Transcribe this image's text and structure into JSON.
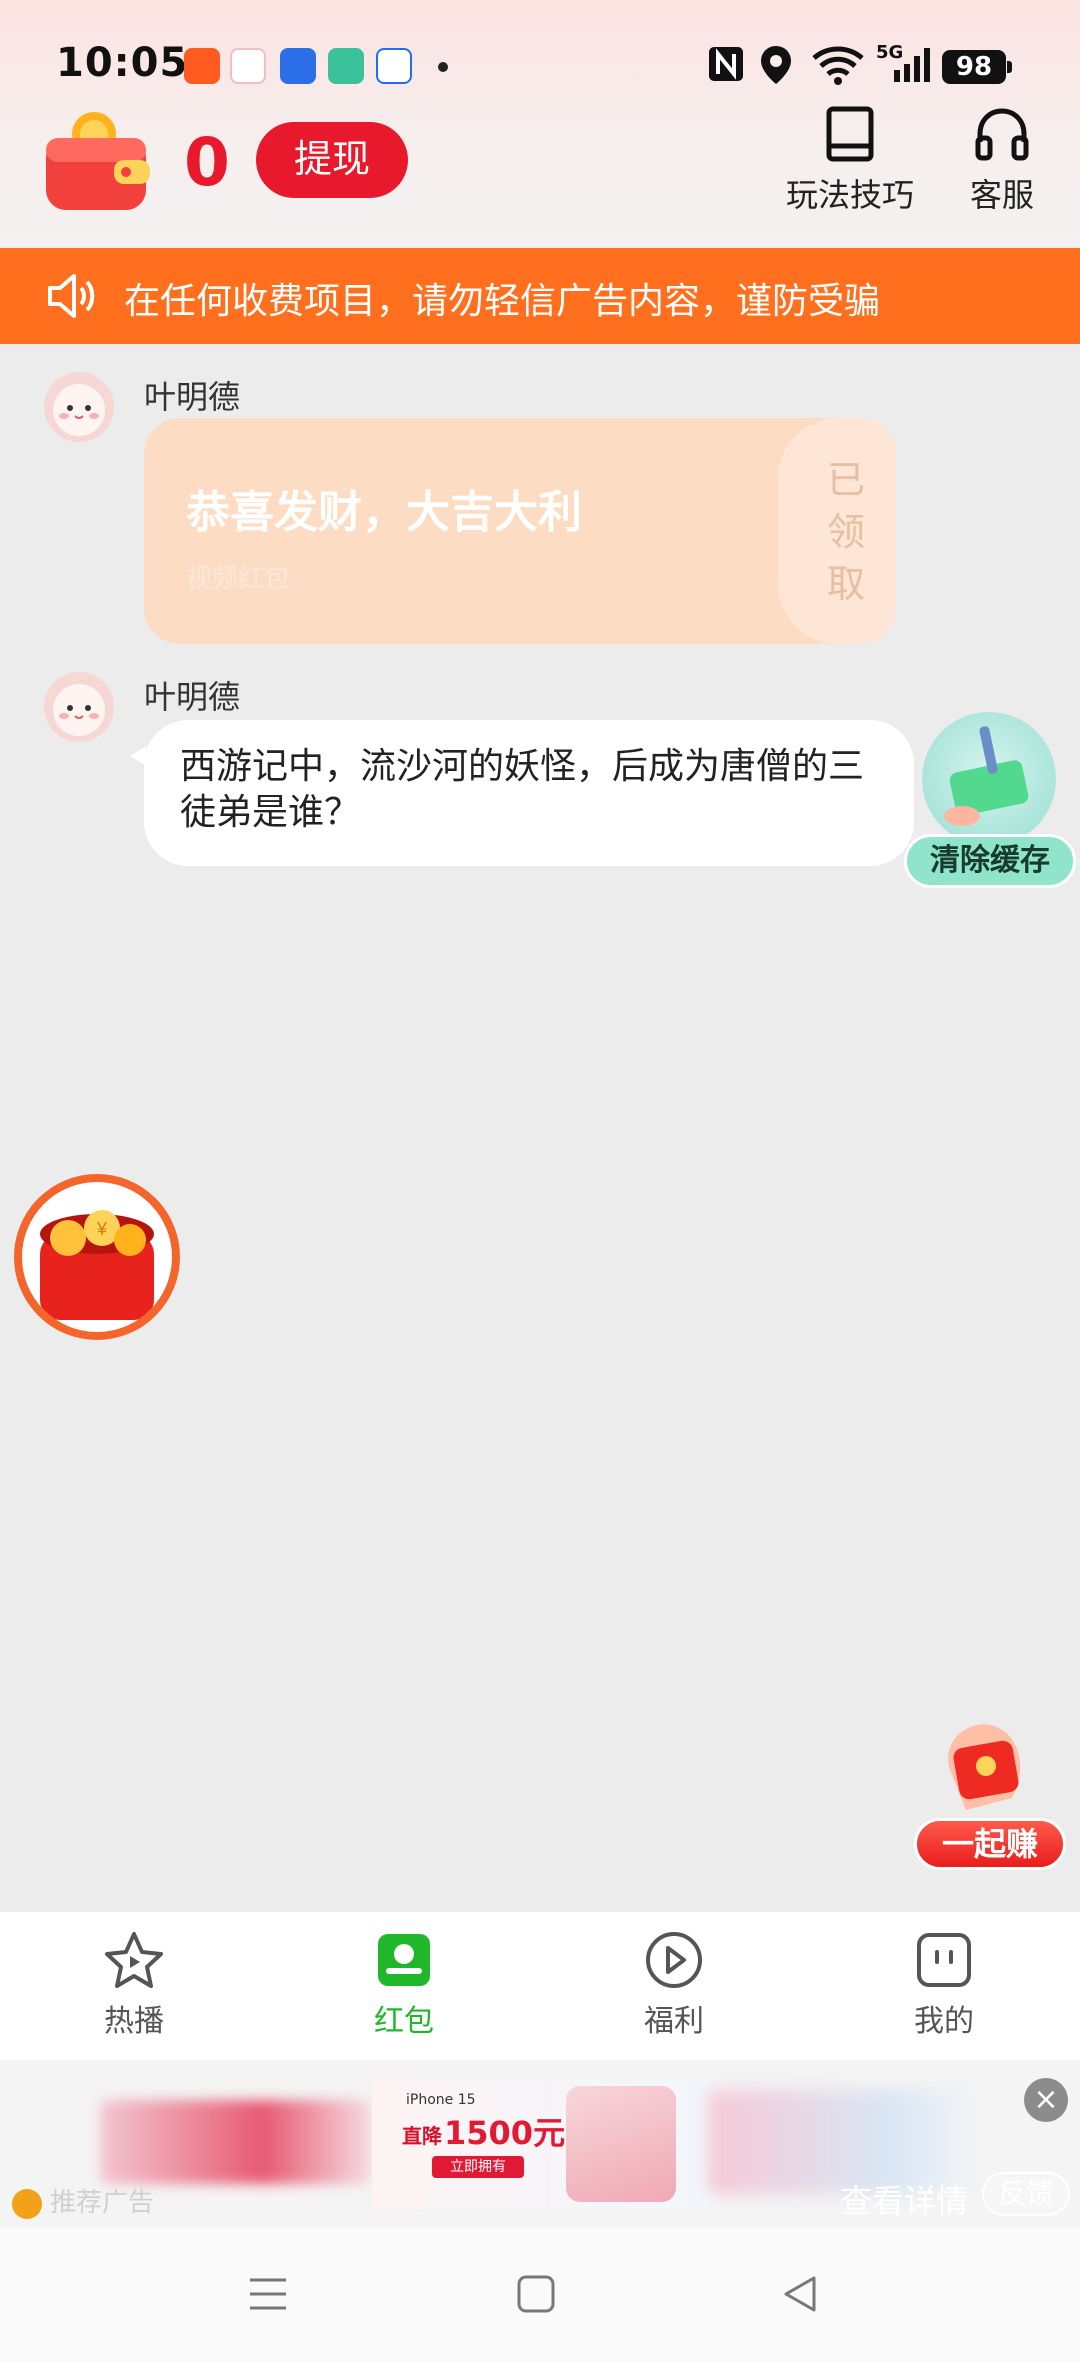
{
  "status_bar": {
    "time": "10:05",
    "battery": "98",
    "network": "5G"
  },
  "header": {
    "balance": "0",
    "withdraw_label": "提现",
    "tips_label": "玩法技巧",
    "service_label": "客服"
  },
  "notice": {
    "text": "在任何收费项目，请勿轻信广告内容，谨防受骗"
  },
  "chat": {
    "messages": [
      {
        "sender": "叶明德",
        "type": "red-packet",
        "title": "恭喜发财，大吉大利",
        "subtitle": "视频红包",
        "status": "已领取"
      },
      {
        "sender": "叶明德",
        "type": "text",
        "text": "西游记中，流沙河的妖怪，后成为唐僧的三徒弟是谁？"
      }
    ]
  },
  "floating": {
    "clear_cache_label": "清除缓存",
    "earn_label": "一起赚"
  },
  "bottom_nav": {
    "items": [
      {
        "label": "热播",
        "icon": "star-play-icon"
      },
      {
        "label": "红包",
        "icon": "red-packet-icon",
        "active": true
      },
      {
        "label": "福利",
        "icon": "play-circle-icon"
      },
      {
        "label": "我的",
        "icon": "profile-icon"
      }
    ],
    "active_color": "#20b82a"
  },
  "ad": {
    "tag": "推荐广告",
    "detail_label": "查看详情",
    "feedback_label": "反馈",
    "model": "iPhone 15",
    "price_prefix": "直降",
    "price": "1500元",
    "cta": "立即拥有"
  },
  "colors": {
    "accent_red": "#e8192c",
    "notice_orange": "#ff6f1d"
  }
}
